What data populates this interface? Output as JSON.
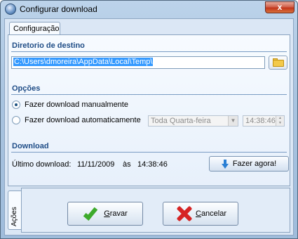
{
  "window": {
    "title": "Configurar download",
    "close_glyph": "x",
    "icon": "app-globe-icon"
  },
  "tabs": [
    {
      "label": "Configuração"
    }
  ],
  "destination": {
    "heading": "Diretorio de destino",
    "path": "C:\\Users\\dmoreira\\AppData\\Local\\Temp\\",
    "browse_icon": "folder-icon"
  },
  "options": {
    "heading": "Opções",
    "manual_label": "Fazer download manualmente",
    "auto_label": "Fazer download automaticamente",
    "selected": "manual",
    "schedule_day": "Toda Quarta-feira",
    "schedule_time": "14:38:46"
  },
  "download": {
    "heading": "Download",
    "last_label": "Último download:",
    "last_date": "11/11/2009",
    "at_label": "às",
    "last_time": "14:38:46",
    "now_button": "Fazer agora!"
  },
  "actions": {
    "panel_label": "Ações",
    "save_button": "Gravar",
    "save_accel": "G",
    "save_rest": "ravar",
    "cancel_button": "Cancelar",
    "cancel_accel": "C",
    "cancel_rest": "ancelar"
  }
}
